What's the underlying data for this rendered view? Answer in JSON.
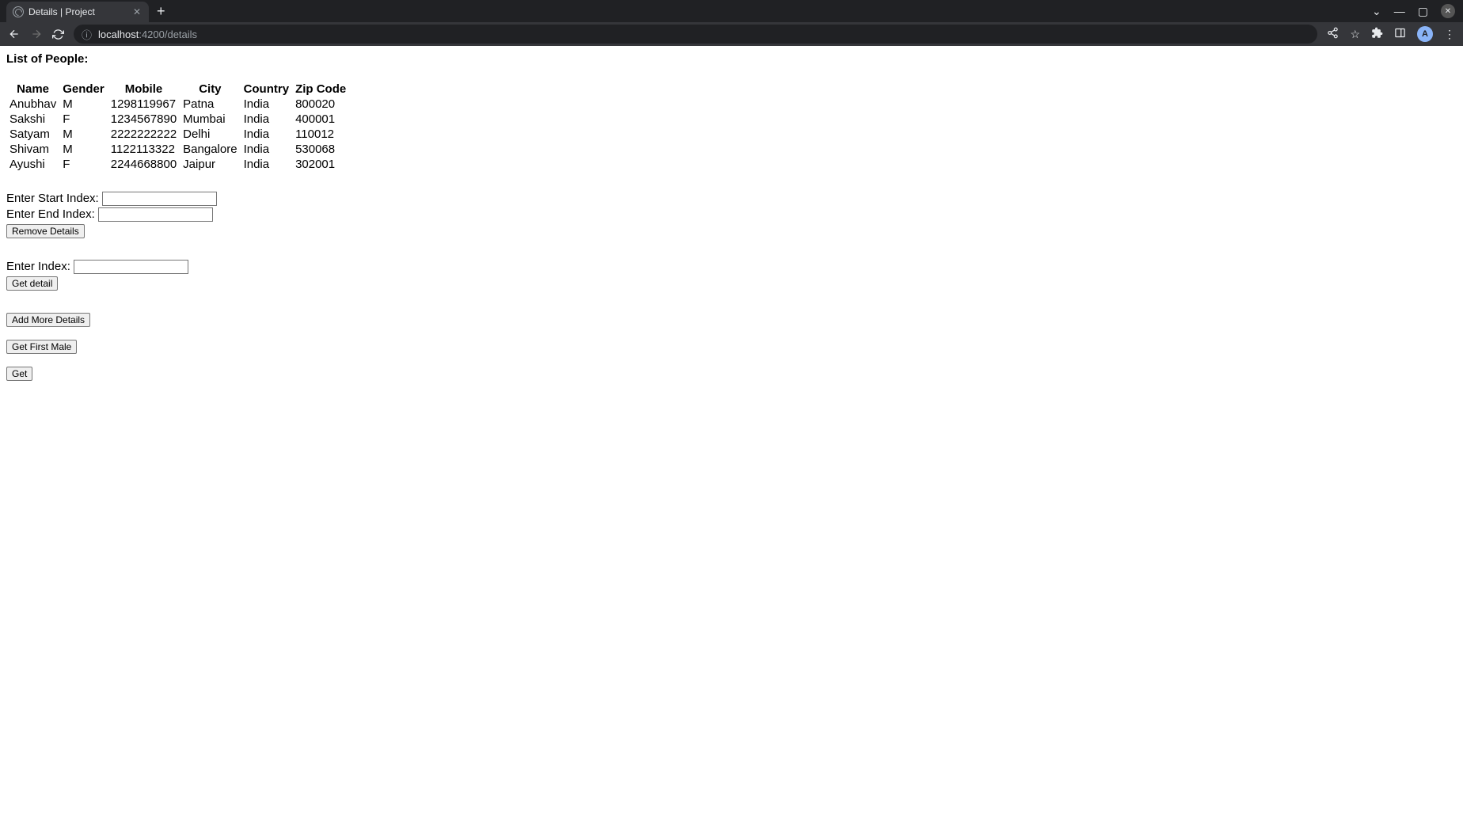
{
  "browser": {
    "tab_title": "Details | Project",
    "url_host": "localhost",
    "url_path": ":4200/details",
    "avatar_initial": "A"
  },
  "page": {
    "heading": "List of People:",
    "table": {
      "headers": [
        "Name",
        "Gender",
        "Mobile",
        "City",
        "Country",
        "Zip Code"
      ],
      "rows": [
        [
          "Anubhav",
          "M",
          "1298119967",
          "Patna",
          "India",
          "800020"
        ],
        [
          "Sakshi",
          "F",
          "1234567890",
          "Mumbai",
          "India",
          "400001"
        ],
        [
          "Satyam",
          "M",
          "2222222222",
          "Delhi",
          "India",
          "110012"
        ],
        [
          "Shivam",
          "M",
          "1122113322",
          "Bangalore",
          "India",
          "530068"
        ],
        [
          "Ayushi",
          "F",
          "2244668800",
          "Jaipur",
          "India",
          "302001"
        ]
      ]
    },
    "form_labels": {
      "start_index": "Enter Start Index: ",
      "end_index": "Enter End Index: ",
      "index": "Enter Index: "
    },
    "buttons": {
      "remove_details": "Remove Details",
      "get_detail": "Get detail",
      "add_more_details": "Add More Details",
      "get_first_male": "Get First Male",
      "get": "Get"
    }
  }
}
